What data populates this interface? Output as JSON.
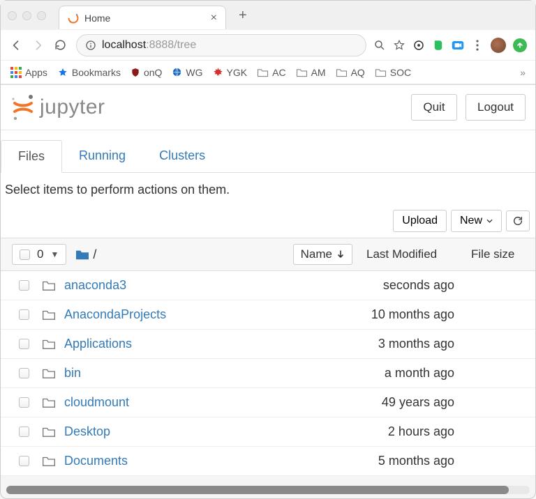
{
  "browser": {
    "tab_title": "Home",
    "url_host": "localhost",
    "url_port": ":8888",
    "url_path": "/tree",
    "bookmarks": {
      "apps": "Apps",
      "bookmarks": "Bookmarks",
      "items": [
        {
          "label": "onQ"
        },
        {
          "label": "WG"
        },
        {
          "label": "YGK"
        },
        {
          "label": "AC"
        },
        {
          "label": "AM"
        },
        {
          "label": "AQ"
        },
        {
          "label": "SOC"
        }
      ]
    }
  },
  "jupyter": {
    "logo_text": "jupyter",
    "quit": "Quit",
    "logout": "Logout",
    "tabs": {
      "files": "Files",
      "running": "Running",
      "clusters": "Clusters"
    },
    "hint": "Select items to perform actions on them.",
    "upload": "Upload",
    "new": "New",
    "selected_count": "0",
    "breadcrumb_root": "/",
    "cols": {
      "name": "Name",
      "modified": "Last Modified",
      "size": "File size"
    },
    "rows": [
      {
        "name": "anaconda3",
        "modified": "seconds ago"
      },
      {
        "name": "AnacondaProjects",
        "modified": "10 months ago"
      },
      {
        "name": "Applications",
        "modified": "3 months ago"
      },
      {
        "name": "bin",
        "modified": "a month ago"
      },
      {
        "name": "cloudmount",
        "modified": "49 years ago"
      },
      {
        "name": "Desktop",
        "modified": "2 hours ago"
      },
      {
        "name": "Documents",
        "modified": "5 months ago"
      }
    ]
  }
}
